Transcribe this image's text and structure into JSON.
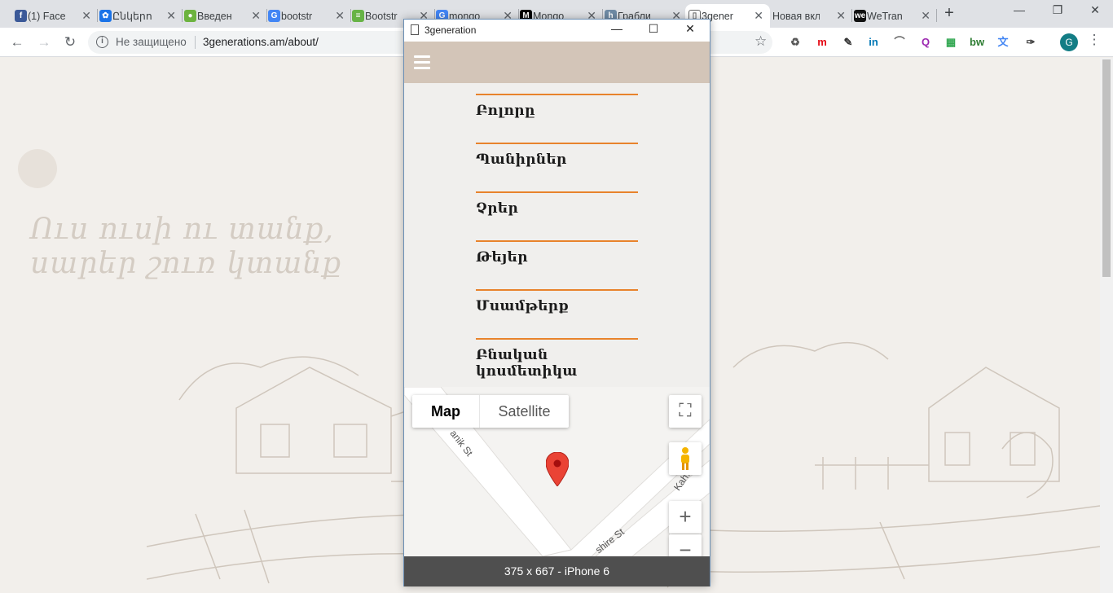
{
  "browser": {
    "tabs": [
      {
        "title": "(1) Face",
        "favicon": "facebook-icon",
        "color": "#3b5998",
        "glyph": "f"
      },
      {
        "title": "Ընկերո",
        "favicon": "gear-icon",
        "color": "#1a73e8",
        "glyph": "✿"
      },
      {
        "title": "Введен",
        "favicon": "leaf-icon",
        "color": "#6db33f",
        "glyph": "●"
      },
      {
        "title": "bootstr",
        "favicon": "google-icon",
        "color": "#4285f4",
        "glyph": "G"
      },
      {
        "title": "Bootstr",
        "favicon": "bootsnipp-icon",
        "color": "#67b346",
        "glyph": "≡"
      },
      {
        "title": "mongo",
        "favicon": "google-icon",
        "color": "#4285f4",
        "glyph": "G"
      },
      {
        "title": "Mongo",
        "favicon": "medium-icon",
        "color": "#000000",
        "glyph": "M"
      },
      {
        "title": "Грабли",
        "favicon": "habr-icon",
        "color": "#6f8ba5",
        "glyph": "h"
      },
      {
        "title": "3gener",
        "favicon": "document-icon",
        "color": "#ffffff",
        "glyph": "▯"
      },
      {
        "title": "Новая вкла",
        "favicon": "",
        "color": "#dfe1e5",
        "glyph": ""
      },
      {
        "title": "WeTran",
        "favicon": "wetransfer-icon",
        "color": "#111111",
        "glyph": "we"
      }
    ],
    "active_tab": 8,
    "new_tab": "+",
    "window_controls": {
      "minimize": "—",
      "maximize": "❐",
      "close": "✕"
    },
    "nav": {
      "back": "←",
      "forward": "→",
      "reload": "↻"
    },
    "omnibox": {
      "info": "i",
      "security": "Не защищено",
      "url": "3generations.am/about/",
      "star": "☆"
    },
    "extensions": [
      {
        "name": "recycle-icon",
        "glyph": "♻",
        "color": "#555555"
      },
      {
        "name": "m-icon",
        "glyph": "m",
        "color": "#e50914"
      },
      {
        "name": "eyedropper-icon",
        "glyph": "✎",
        "color": "#333333"
      },
      {
        "name": "linkedin-icon",
        "glyph": "in",
        "color": "#0077b5"
      },
      {
        "name": "mountain-icon",
        "glyph": "⌒",
        "color": "#666666"
      },
      {
        "name": "search-ext-icon",
        "glyph": "Q",
        "color": "#9c27b0"
      },
      {
        "name": "grid-icon",
        "glyph": "▦",
        "color": "#34a853"
      },
      {
        "name": "bw-icon",
        "glyph": "bw",
        "color": "#2e7d32"
      },
      {
        "name": "translate-icon",
        "glyph": "文",
        "color": "#4285f4"
      },
      {
        "name": "pipette-icon",
        "glyph": "✑",
        "color": "#444444"
      }
    ],
    "profile": "G",
    "menu": "⋮"
  },
  "page": {
    "slogan_line1": "Ուս ուսի ու տանք,",
    "slogan_line2": "սարեր շուռ կտանք"
  },
  "device_window": {
    "title": "3generation",
    "controls": {
      "minimize": "—",
      "maximize": "☐",
      "close": "✕"
    },
    "categories": [
      "Բոլորը",
      "Պանիրներ",
      "Չրեր",
      "Թեյեր",
      "Մսամթերք",
      "Բնական կոսմետիկա"
    ],
    "map": {
      "type_map": "Map",
      "type_satellite": "Satellite",
      "fullscreen": "⛶",
      "pegman": "pegman",
      "zoom_in": "+",
      "zoom_out": "−",
      "streets": [
        "anik St",
        "Kah... St",
        "shire St"
      ]
    },
    "status": "375 x 667 - iPhone 6"
  }
}
